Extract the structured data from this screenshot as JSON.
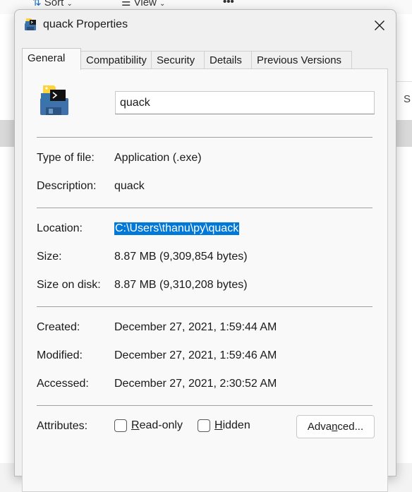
{
  "background": {
    "toolbar": {
      "sort_label": "Sort",
      "view_label": "View",
      "more_label": "•••"
    },
    "cutoff_text": "S"
  },
  "dialog": {
    "title": "quack Properties",
    "tabs": [
      {
        "label": "General",
        "active": true
      },
      {
        "label": "Compatibility",
        "active": false
      },
      {
        "label": "Security",
        "active": false
      },
      {
        "label": "Details",
        "active": false
      },
      {
        "label": "Previous Versions",
        "active": false
      }
    ],
    "file_name": "quack",
    "rows": {
      "type": {
        "label": "Type of file:",
        "value": "Application (.exe)"
      },
      "description": {
        "label": "Description:",
        "value": "quack"
      },
      "location": {
        "label": "Location:",
        "value": "C:\\Users\\thanu\\py\\quack"
      },
      "size": {
        "label": "Size:",
        "value": "8.87 MB (9,309,854 bytes)"
      },
      "size_on_disk": {
        "label": "Size on disk:",
        "value": "8.87 MB (9,310,208 bytes)"
      },
      "created": {
        "label": "Created:",
        "value": "December 27, 2021, 1:59:44 AM"
      },
      "modified": {
        "label": "Modified:",
        "value": "December 27, 2021, 1:59:46 AM"
      },
      "accessed": {
        "label": "Accessed:",
        "value": "December 27, 2021, 2:30:52 AM"
      }
    },
    "attributes": {
      "label": "Attributes:",
      "readonly": {
        "label_first": "R",
        "label_rest": "ead-only",
        "checked": false
      },
      "hidden": {
        "label_first": "H",
        "label_rest": "idden",
        "checked": false
      },
      "advanced": {
        "label_before": "Adva",
        "label_underline": "n",
        "label_after": "ced..."
      }
    },
    "icons": {
      "title_icon": "python-app-icon",
      "file_icon": "python-app-icon",
      "close_icon": "close-icon"
    },
    "colors": {
      "selection": "#0078d7",
      "python_blue": "#3776ab",
      "python_yellow": "#ffd43b"
    }
  }
}
